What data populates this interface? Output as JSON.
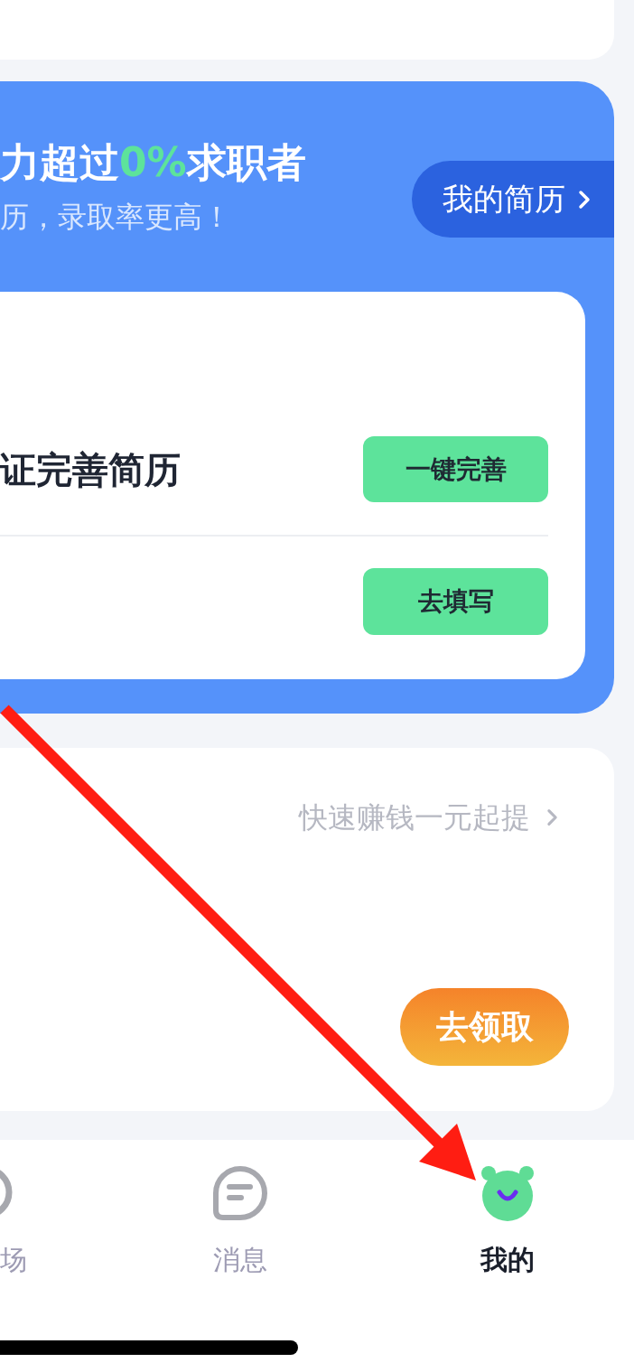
{
  "resume_card": {
    "headline": [
      {
        "text": "力超过",
        "highlight": false
      },
      {
        "text": "0%",
        "highlight": true
      },
      {
        "text": "求职者",
        "highlight": false
      }
    ],
    "subtitle": "历，录取率更高！",
    "resume_button": "我的简历",
    "tasks": [
      {
        "text": "证完善简历",
        "button": "一键完善"
      },
      {
        "button": "去填写"
      }
    ]
  },
  "earn_card": {
    "link": "快速赚钱一元起提",
    "button": "去领取"
  },
  "tab_bar": {
    "tabs": [
      {
        "label": "场",
        "selected": false
      },
      {
        "label": "消息",
        "selected": false
      },
      {
        "label": "我的",
        "selected": true
      }
    ]
  }
}
